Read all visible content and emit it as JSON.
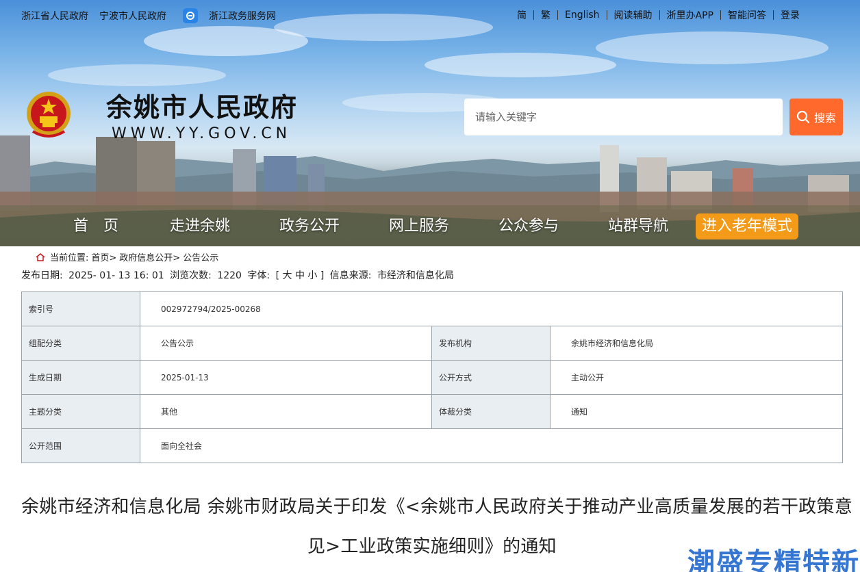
{
  "topbar": {
    "left_links": [
      "浙江省人民政府",
      "宁波市人民政府"
    ],
    "service_link": "浙江政务服务网",
    "right_links": [
      "简",
      "繁",
      "English",
      "阅读辅助",
      "浙里办APP",
      "智能问答",
      "登录"
    ]
  },
  "header": {
    "title": "余姚市人民政府",
    "url": "WWW.YY.GOV.CN"
  },
  "search": {
    "placeholder": "请输入关键字",
    "button_label": "搜索"
  },
  "nav": {
    "items": [
      "首　页",
      "走进余姚",
      "政务公开",
      "网上服务",
      "公众参与",
      "站群导航"
    ],
    "elder_mode": "进入老年模式"
  },
  "breadcrumb": {
    "prefix": "当前位置:",
    "items": [
      "首页>",
      "政府信息公开>",
      "公告公示"
    ]
  },
  "meta": {
    "date_label": "发布日期:",
    "date_value": "2025- 01- 13 16: 01",
    "views_label": "浏览次数:",
    "views_value": "1220",
    "font_label": "字体:",
    "font_sizes": "[ 大 中 小 ]",
    "source_label": "信息来源:",
    "source_value": "市经济和信息化局"
  },
  "info": {
    "index_label": "索引号",
    "index_value": "002972794/2025-00268",
    "category_label": "组配分类",
    "category_value": "公告公示",
    "publisher_label": "发布机构",
    "publisher_value": "余姚市经济和信息化局",
    "created_label": "生成日期",
    "created_value": "2025-01-13",
    "method_label": "公开方式",
    "method_value": "主动公开",
    "topic_label": "主题分类",
    "topic_value": "其他",
    "genre_label": "体裁分类",
    "genre_value": "通知",
    "scope_label": "公开范围",
    "scope_value": "面向全社会"
  },
  "article": {
    "title_line1": "余姚市经济和信息化局 余姚市财政局关于印发《<余姚市人民政府关于推动产业高质量发展的若干政策意",
    "title_line2": "见>工业政策实施细则》的通知"
  },
  "watermark": "潮盛专精特新",
  "colors": {
    "search_button": "#ff6a2c",
    "elder_button": "#f39a19",
    "table_key_bg": "#e9eef3",
    "table_border": "#9aa2aa"
  }
}
